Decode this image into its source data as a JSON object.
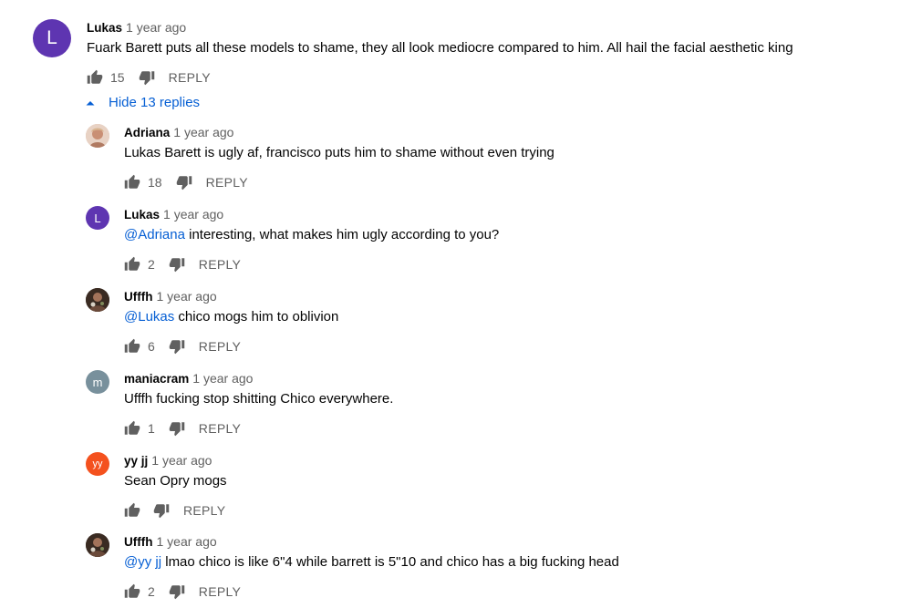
{
  "top_comment": {
    "avatar_letter": "L",
    "avatar_color": "#5e35b1",
    "author": "Lukas",
    "time": "1 year ago",
    "text": "Fuark Barett puts all these models to shame, they all look mediocre compared to him. All hail the facial aesthetic king",
    "likes": "15",
    "reply_label": "REPLY"
  },
  "replies_toggle": {
    "label": "Hide 13 replies",
    "icon": "caret-up-icon"
  },
  "replies": [
    {
      "avatar_type": "photo",
      "avatar_color": "#d9b6a3",
      "author": "Adriana",
      "time": "1 year ago",
      "mention": "",
      "text": "Lukas Barett is ugly af, francisco puts him to shame without even trying",
      "likes": "18",
      "reply_label": "REPLY"
    },
    {
      "avatar_type": "letter",
      "avatar_letter": "L",
      "avatar_color": "#5e35b1",
      "author": "Lukas",
      "time": "1 year ago",
      "mention": "@Adriana",
      "text": " interesting, what makes him ugly according to you?",
      "likes": "2",
      "reply_label": "REPLY"
    },
    {
      "avatar_type": "photo",
      "avatar_color": "#4a3a2e",
      "author": "Ufffh",
      "time": "1 year ago",
      "mention": "@Lukas",
      "text": " chico mogs him to oblivion",
      "likes": "6",
      "reply_label": "REPLY"
    },
    {
      "avatar_type": "letter",
      "avatar_letter": "m",
      "avatar_color": "#78909c",
      "author": "maniacram",
      "time": "1 year ago",
      "mention": "",
      "text": "Ufffh fucking stop shitting Chico everywhere.",
      "likes": "1",
      "reply_label": "REPLY"
    },
    {
      "avatar_type": "letter",
      "avatar_letter": "yy",
      "avatar_color": "#f4511e",
      "author": "yy jj",
      "time": "1 year ago",
      "mention": "",
      "text": "Sean Opry mogs",
      "likes": "",
      "reply_label": "REPLY"
    },
    {
      "avatar_type": "photo",
      "avatar_color": "#4a3a2e",
      "author": "Ufffh",
      "time": "1 year ago",
      "mention": "@yy jj",
      "text": " lmao chico is like 6\"4 while barrett is 5\"10 and chico has a big fucking head",
      "likes": "2",
      "reply_label": "REPLY"
    }
  ]
}
